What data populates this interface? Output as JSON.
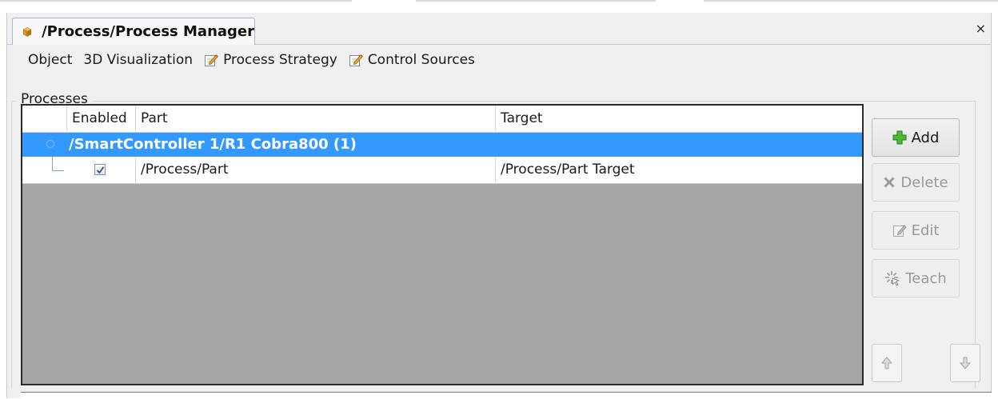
{
  "window": {
    "tab_title": "/Process/Process Manager",
    "close_label": "×"
  },
  "menu": {
    "items": [
      {
        "label": "Object",
        "icon": null
      },
      {
        "label": "3D Visualization",
        "icon": null
      },
      {
        "label": "Process Strategy",
        "icon": "edit-icon"
      },
      {
        "label": "Control Sources",
        "icon": "edit-icon"
      }
    ]
  },
  "processes": {
    "group_label": "Processes",
    "columns": [
      "Enabled",
      "Part",
      "Target"
    ],
    "group_row": "/SmartController 1/R1 Cobra800   (1)",
    "rows": [
      {
        "enabled": true,
        "part": "/Process/Part",
        "target": "/Process/Part Target"
      }
    ]
  },
  "buttons": {
    "add": "Add",
    "delete": "Delete",
    "edit": "Edit",
    "teach": "Teach"
  },
  "colors": {
    "selection": "#3399ff",
    "grid_empty": "#a6a6a6",
    "add_icon": "#3fae2a"
  }
}
